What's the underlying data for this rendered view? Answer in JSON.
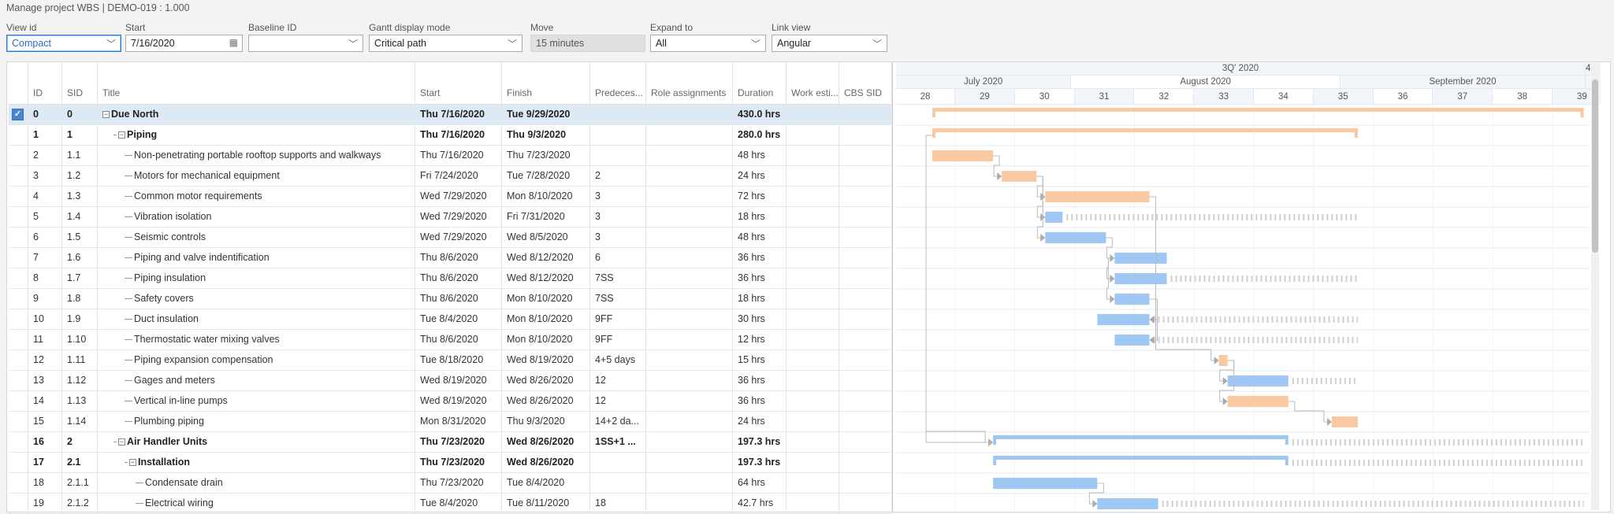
{
  "page_title": "Manage project WBS  |  DEMO-019 : 1.000",
  "toolbar": {
    "view_id": {
      "label": "View id",
      "value": "Compact"
    },
    "start": {
      "label": "Start",
      "value": "7/16/2020"
    },
    "baseline": {
      "label": "Baseline ID",
      "value": ""
    },
    "gantt_mode": {
      "label": "Gantt display mode",
      "value": "Critical path"
    },
    "move": {
      "label": "Move",
      "value": "15 minutes"
    },
    "expand": {
      "label": "Expand to",
      "value": "All"
    },
    "link_view": {
      "label": "Link view",
      "value": "Angular"
    }
  },
  "columns": [
    "ID",
    "SID",
    "Title",
    "Start",
    "Finish",
    "Predeces...",
    "Role assignments",
    "Duration",
    "Work esti...",
    "CBS SID"
  ],
  "colors": {
    "critical": "#f9c9a2",
    "normal": "#9ec8f3",
    "slack": "#cfcfcf",
    "selected_row": "#dde9f5"
  },
  "timeline": {
    "quarter": "3Q' 2020",
    "quarter_next": "4.",
    "months": [
      "July 2020",
      "August 2020",
      "September 2020"
    ],
    "weeks": [
      "28",
      "29",
      "30",
      "31",
      "32",
      "33",
      "34",
      "35",
      "36",
      "37",
      "38",
      "39"
    ]
  },
  "rows": [
    {
      "id": "0",
      "sid": "0",
      "title": "Due North",
      "start": "Thu 7/16/2020",
      "finish": "Tue 9/29/2020",
      "pred": "",
      "duration": "430.0 hrs",
      "level": 0,
      "summary": true,
      "critical": true,
      "selected": true
    },
    {
      "id": "1",
      "sid": "1",
      "title": "Piping",
      "start": "Thu 7/16/2020",
      "finish": "Thu 9/3/2020",
      "pred": "",
      "duration": "280.0 hrs",
      "level": 1,
      "summary": true,
      "critical": true
    },
    {
      "id": "2",
      "sid": "1.1",
      "title": "Non-penetrating portable rooftop supports and walkways",
      "start": "Thu 7/16/2020",
      "finish": "Thu 7/23/2020",
      "pred": "",
      "duration": "48 hrs",
      "level": 2,
      "critical": true
    },
    {
      "id": "3",
      "sid": "1.2",
      "title": "Motors for mechanical equipment",
      "start": "Fri 7/24/2020",
      "finish": "Tue 7/28/2020",
      "pred": "2",
      "duration": "24 hrs",
      "level": 2,
      "critical": true
    },
    {
      "id": "4",
      "sid": "1.3",
      "title": "Common motor requirements",
      "start": "Wed 7/29/2020",
      "finish": "Mon 8/10/2020",
      "pred": "3",
      "duration": "72 hrs",
      "level": 2,
      "critical": true
    },
    {
      "id": "5",
      "sid": "1.4",
      "title": "Vibration isolation",
      "start": "Wed 7/29/2020",
      "finish": "Fri 7/31/2020",
      "pred": "3",
      "duration": "18 hrs",
      "level": 2,
      "critical": false,
      "slack_until": "9/3/2020"
    },
    {
      "id": "6",
      "sid": "1.5",
      "title": "Seismic controls",
      "start": "Wed 7/29/2020",
      "finish": "Wed 8/5/2020",
      "pred": "3",
      "duration": "48 hrs",
      "level": 2,
      "critical": false
    },
    {
      "id": "7",
      "sid": "1.6",
      "title": "Piping and valve indentification",
      "start": "Thu 8/6/2020",
      "finish": "Wed 8/12/2020",
      "pred": "6",
      "duration": "36 hrs",
      "level": 2,
      "critical": false
    },
    {
      "id": "8",
      "sid": "1.7",
      "title": "Piping insulation",
      "start": "Thu 8/6/2020",
      "finish": "Wed 8/12/2020",
      "pred": "7SS",
      "duration": "36 hrs",
      "level": 2,
      "critical": false,
      "slack_until": "9/3/2020"
    },
    {
      "id": "9",
      "sid": "1.8",
      "title": "Safety covers",
      "start": "Thu 8/6/2020",
      "finish": "Mon 8/10/2020",
      "pred": "7SS",
      "duration": "18 hrs",
      "level": 2,
      "critical": false
    },
    {
      "id": "10",
      "sid": "1.9",
      "title": "Duct insulation",
      "start": "Tue 8/4/2020",
      "finish": "Mon 8/10/2020",
      "pred": "9FF",
      "duration": "30 hrs",
      "level": 2,
      "critical": false,
      "slack_until": "9/3/2020"
    },
    {
      "id": "11",
      "sid": "1.10",
      "title": "Thermostatic water mixing valves",
      "start": "Thu 8/6/2020",
      "finish": "Mon 8/10/2020",
      "pred": "9FF",
      "duration": "12 hrs",
      "level": 2,
      "critical": false,
      "slack_until": "9/3/2020"
    },
    {
      "id": "12",
      "sid": "1.11",
      "title": "Piping expansion compensation",
      "start": "Tue 8/18/2020",
      "finish": "Wed 8/19/2020",
      "pred": "4+5 days",
      "duration": "15 hrs",
      "level": 2,
      "critical": true
    },
    {
      "id": "13",
      "sid": "1.12",
      "title": "Gages and meters",
      "start": "Wed 8/19/2020",
      "finish": "Wed 8/26/2020",
      "pred": "12",
      "duration": "36 hrs",
      "level": 2,
      "critical": false,
      "slack_until": "9/3/2020"
    },
    {
      "id": "14",
      "sid": "1.13",
      "title": "Vertical in-line pumps",
      "start": "Wed 8/19/2020",
      "finish": "Wed 8/26/2020",
      "pred": "12",
      "duration": "36 hrs",
      "level": 2,
      "critical": true
    },
    {
      "id": "15",
      "sid": "1.14",
      "title": "Plumbing piping",
      "start": "Mon 8/31/2020",
      "finish": "Thu 9/3/2020",
      "pred": "14+2 da...",
      "duration": "24 hrs",
      "level": 2,
      "critical": true,
      "last": true
    },
    {
      "id": "16",
      "sid": "2",
      "title": "Air Handler Units",
      "start": "Thu 7/23/2020",
      "finish": "Wed 8/26/2020",
      "pred": "1SS+1 ...",
      "duration": "197.3 hrs",
      "level": 1,
      "summary": true,
      "critical": false,
      "slack_until": "9/29/2020"
    },
    {
      "id": "17",
      "sid": "2.1",
      "title": "Installation",
      "start": "Thu 7/23/2020",
      "finish": "Wed 8/26/2020",
      "pred": "",
      "duration": "197.3 hrs",
      "level": 2,
      "summary": true,
      "critical": false,
      "slack_until": "9/29/2020"
    },
    {
      "id": "18",
      "sid": "2.1.1",
      "title": "Condensate drain",
      "start": "Thu 7/23/2020",
      "finish": "Tue 8/4/2020",
      "pred": "",
      "duration": "64 hrs",
      "level": 3,
      "critical": false
    },
    {
      "id": "19",
      "sid": "2.1.2",
      "title": "Electrical wiring",
      "start": "Tue 8/4/2020",
      "finish": "Tue 8/11/2020",
      "pred": "18",
      "duration": "42.7 hrs",
      "level": 3,
      "critical": false,
      "slack_until": "9/29/2020"
    }
  ]
}
